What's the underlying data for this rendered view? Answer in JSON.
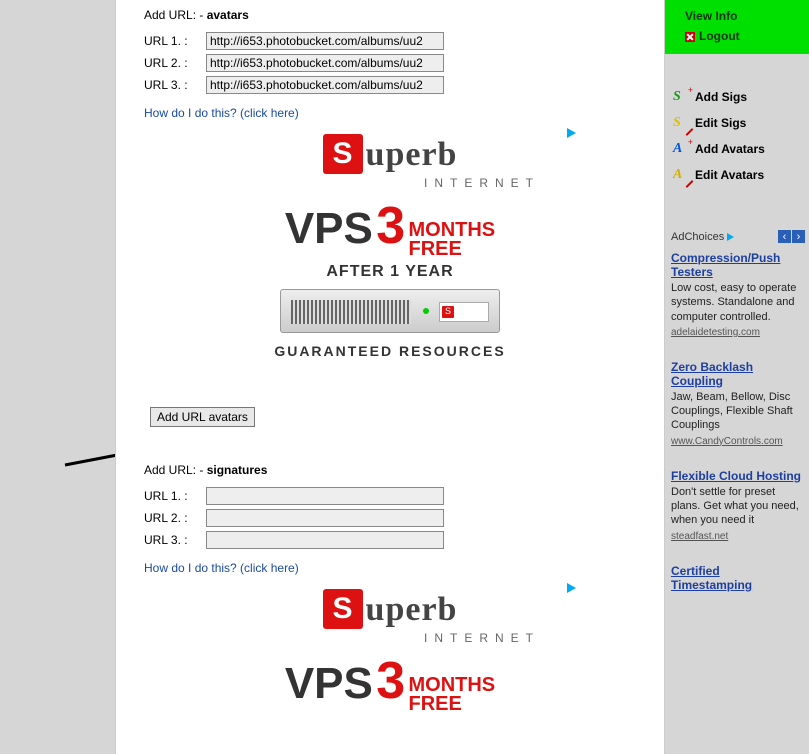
{
  "avatars": {
    "title_prefix": "Add URL: - ",
    "title_bold": "avatars",
    "rows": [
      {
        "label": "URL 1. :",
        "value": "http://i653.photobucket.com/albums/uu2"
      },
      {
        "label": "URL 2. :",
        "value": "http://i653.photobucket.com/albums/uu2"
      },
      {
        "label": "URL 3. :",
        "value": "http://i653.photobucket.com/albums/uu2"
      }
    ],
    "help": "How do I do this? (click here)",
    "button": "Add URL avatars"
  },
  "signatures": {
    "title_prefix": "Add URL: - ",
    "title_bold": "signatures",
    "rows": [
      {
        "label": "URL 1. :",
        "value": ""
      },
      {
        "label": "URL 2. :",
        "value": ""
      },
      {
        "label": "URL 3. :",
        "value": ""
      }
    ],
    "help": "How do I do this? (click here)"
  },
  "ad_banner": {
    "brand_s": "S",
    "brand_rest": "uperb",
    "brand_sub": "INTERNET",
    "vps": "VPS",
    "three": "3",
    "months": "MONTHS",
    "free": "FREE",
    "after": "AFTER 1 YEAR",
    "footer": "GUARANTEED RESOURCES"
  },
  "right_nav": {
    "view_info": "View Info",
    "logout": "Logout",
    "items": [
      {
        "label": "Add Sigs"
      },
      {
        "label": "Edit Sigs"
      },
      {
        "label": "Add Avatars"
      },
      {
        "label": "Edit Avatars"
      }
    ]
  },
  "adchoices": {
    "label": "AdChoices",
    "prev": "‹",
    "next": "›"
  },
  "side_ads": [
    {
      "title": "Compression/Push Testers",
      "desc": "Low cost, easy to operate systems. Standalone and computer controlled.",
      "domain": "adelaidetesting.com"
    },
    {
      "title": "Zero Backlash Coupling",
      "desc": "Jaw, Beam, Bellow, Disc Couplings, Flexible Shaft Couplings",
      "domain": "www.CandyControls.com"
    },
    {
      "title": "Flexible Cloud Hosting",
      "desc": "Don't settle for preset plans. Get what you need, when you need it",
      "domain": "steadfast.net"
    },
    {
      "title": "Certified Timestamping",
      "desc": "",
      "domain": ""
    }
  ]
}
